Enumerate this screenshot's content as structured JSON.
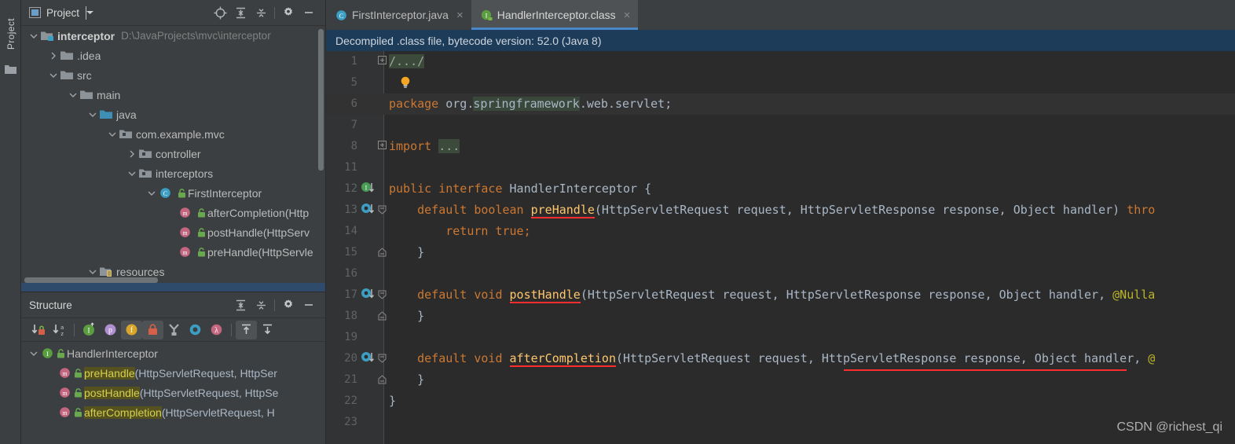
{
  "toolstrip": {
    "project_tab": "Project",
    "folder_icon": "folder-icon"
  },
  "project_panel": {
    "title": "Project",
    "icons": {
      "project_icon": "project-view-icon",
      "caret": "chevron-down-icon",
      "locate": "locate-target-icon",
      "expand_all": "expand-all-icon",
      "collapse_all": "collapse-all-icon",
      "settings": "gear-icon",
      "hide": "minimize-icon"
    },
    "tree": [
      {
        "label": "interceptor",
        "path": "D:\\JavaProjects\\mvc\\interceptor",
        "indent": 0,
        "arrow": "down",
        "icon": "module-folder-icon",
        "bold": true
      },
      {
        "label": ".idea",
        "path": "",
        "indent": 1,
        "arrow": "right",
        "icon": "folder-icon",
        "bold": false
      },
      {
        "label": "src",
        "path": "",
        "indent": 1,
        "arrow": "down",
        "icon": "folder-icon",
        "bold": false
      },
      {
        "label": "main",
        "path": "",
        "indent": 2,
        "arrow": "down",
        "icon": "folder-icon",
        "bold": false
      },
      {
        "label": "java",
        "path": "",
        "indent": 3,
        "arrow": "down",
        "icon": "source-root-folder-icon",
        "bold": false
      },
      {
        "label": "com.example.mvc",
        "path": "",
        "indent": 4,
        "arrow": "down",
        "icon": "package-icon",
        "bold": false
      },
      {
        "label": "controller",
        "path": "",
        "indent": 5,
        "arrow": "right",
        "icon": "package-icon",
        "bold": false
      },
      {
        "label": "interceptors",
        "path": "",
        "indent": 5,
        "arrow": "down",
        "icon": "package-icon",
        "bold": false
      },
      {
        "label": "FirstInterceptor",
        "path": "",
        "indent": 6,
        "arrow": "down",
        "icon": "java-class-icon",
        "bold": false
      },
      {
        "label": "afterCompletion(Http",
        "path": "",
        "indent": 7,
        "arrow": "none",
        "icon": "method-icon",
        "bold": false
      },
      {
        "label": "postHandle(HttpServ",
        "path": "",
        "indent": 7,
        "arrow": "none",
        "icon": "method-icon",
        "bold": false
      },
      {
        "label": "preHandle(HttpServle",
        "path": "",
        "indent": 7,
        "arrow": "none",
        "icon": "method-icon",
        "bold": false
      },
      {
        "label": "resources",
        "path": "",
        "indent": 3,
        "arrow": "down",
        "icon": "resources-folder-icon",
        "bold": false
      }
    ]
  },
  "structure_panel": {
    "title": "Structure",
    "icons": {
      "expand_all": "expand-all-icon",
      "collapse_all": "collapse-all-icon",
      "settings": "gear-icon",
      "hide": "minimize-icon"
    },
    "toolbar_buttons": [
      {
        "name": "sort-by-visibility-button",
        "glyph": "↓",
        "badge": "lock",
        "active": false
      },
      {
        "name": "sort-alphabetically-button",
        "glyph": "↓",
        "badge": "az",
        "active": false
      },
      {
        "name": "show-inherited-button",
        "glyph": "I",
        "active": false
      },
      {
        "name": "show-properties-button",
        "glyph": "p",
        "active": false
      },
      {
        "name": "show-fields-button",
        "glyph": "f",
        "active": true
      },
      {
        "name": "show-non-public-button",
        "glyph": "ὑ2",
        "active": true
      },
      {
        "name": "show-anonymous-classes-button",
        "glyph": "Y",
        "active": false
      },
      {
        "name": "group-methods-button",
        "glyph": "O",
        "active": false
      },
      {
        "name": "show-lambdas-button",
        "glyph": "λ",
        "active": false
      },
      {
        "name": "expand-all-structure-button",
        "glyph": "↑",
        "active": true
      },
      {
        "name": "collapse-all-structure-button",
        "glyph": "↓",
        "active": false
      }
    ],
    "tree": [
      {
        "indent": 0,
        "arrow": "down",
        "icon": "interface-icon",
        "lock": true,
        "name": "HandlerInterceptor",
        "rest": "",
        "highlight": false
      },
      {
        "indent": 1,
        "arrow": "none",
        "icon": "method-icon",
        "lock": true,
        "name": "preHandle",
        "rest": "(HttpServletRequest, HttpSer",
        "highlight": true
      },
      {
        "indent": 1,
        "arrow": "none",
        "icon": "method-icon",
        "lock": true,
        "name": "postHandle",
        "rest": "(HttpServletRequest, HttpSe",
        "highlight": true
      },
      {
        "indent": 1,
        "arrow": "none",
        "icon": "method-icon",
        "lock": true,
        "name": "afterCompletion",
        "rest": "(HttpServletRequest, H",
        "highlight": true
      }
    ]
  },
  "editor": {
    "tabs": [
      {
        "label": "FirstInterceptor.java",
        "icon": "java-class-icon",
        "active": false,
        "close": "×"
      },
      {
        "label": "HandlerInterceptor.class",
        "icon": "interface-icon",
        "active": true,
        "close": "×"
      }
    ],
    "notice": "Decompiled .class file, bytecode version: 52.0 (Java 8)",
    "lines": [
      {
        "num": "1",
        "gutter": "",
        "fold": "plus",
        "caret": false
      },
      {
        "num": "5",
        "gutter": "",
        "fold": "",
        "caret": false
      },
      {
        "num": "6",
        "gutter": "",
        "fold": "",
        "caret": true
      },
      {
        "num": "7",
        "gutter": "",
        "fold": "",
        "caret": false
      },
      {
        "num": "8",
        "gutter": "",
        "fold": "plus",
        "caret": false
      },
      {
        "num": "11",
        "gutter": "",
        "fold": "",
        "caret": false
      },
      {
        "num": "12",
        "gutter": "implemented-interface-icon",
        "fold": "",
        "caret": false
      },
      {
        "num": "13",
        "gutter": "overridden-method-icon",
        "fold": "start",
        "caret": false
      },
      {
        "num": "14",
        "gutter": "",
        "fold": "",
        "caret": false
      },
      {
        "num": "15",
        "gutter": "",
        "fold": "end",
        "caret": false
      },
      {
        "num": "16",
        "gutter": "",
        "fold": "",
        "caret": false
      },
      {
        "num": "17",
        "gutter": "overridden-method-icon",
        "fold": "start",
        "caret": false
      },
      {
        "num": "18",
        "gutter": "",
        "fold": "end",
        "caret": false
      },
      {
        "num": "19",
        "gutter": "",
        "fold": "",
        "caret": false
      },
      {
        "num": "20",
        "gutter": "overridden-method-icon",
        "fold": "start",
        "caret": false
      },
      {
        "num": "21",
        "gutter": "",
        "fold": "end",
        "caret": false
      },
      {
        "num": "22",
        "gutter": "",
        "fold": "",
        "caret": false
      },
      {
        "num": "23",
        "gutter": "",
        "fold": "",
        "caret": false
      }
    ],
    "code": {
      "l1_placeholder": "/.../",
      "l5_bulb": "intention-bulb-icon",
      "l6_kw": "package",
      "l6_pkg_a": " org.",
      "l6_pkg_hl": "springframework",
      "l6_pkg_b": ".web.servlet;",
      "l8_kw": "import",
      "l8_placeholder": "...",
      "l12_a": "public interface ",
      "l12_b": "HandlerInterceptor",
      "l12_c": " {",
      "l13_kw": "default boolean ",
      "l13_m": "preHandle",
      "l13_rest": "(HttpServletRequest request, HttpServletResponse response, Object handler) ",
      "l13_tail": "thro",
      "l14": "return true;",
      "l15": "}",
      "l17_kw": "default void ",
      "l17_m": "postHandle",
      "l17_rest": "(HttpServletRequest request, HttpServletResponse response, Object handler, ",
      "l17_tail": "@Nulla",
      "l18": "}",
      "l20_kw": "default void ",
      "l20_m": "afterCompletion",
      "l20_rest": "(HttpServletRequest request, HttpServletResponse response, Object handler, ",
      "l20_tail": "@",
      "l21": "}",
      "l22": "}"
    }
  },
  "watermark": "CSDN @richest_qi",
  "colors": {
    "panel_bg": "#3c3f41",
    "editor_bg": "#2b2b2b",
    "gutter_bg": "#313335",
    "tab_active": "#4e5254",
    "tab_underline": "#4a88c7",
    "notice_bg": "#1d3c59",
    "keyword": "#cc7832",
    "method": "#ffc66d",
    "annotation": "#bbb529",
    "text": "#a9b7c6",
    "error_underline": "#ff2e2e",
    "structure_highlight": "#55521f"
  }
}
